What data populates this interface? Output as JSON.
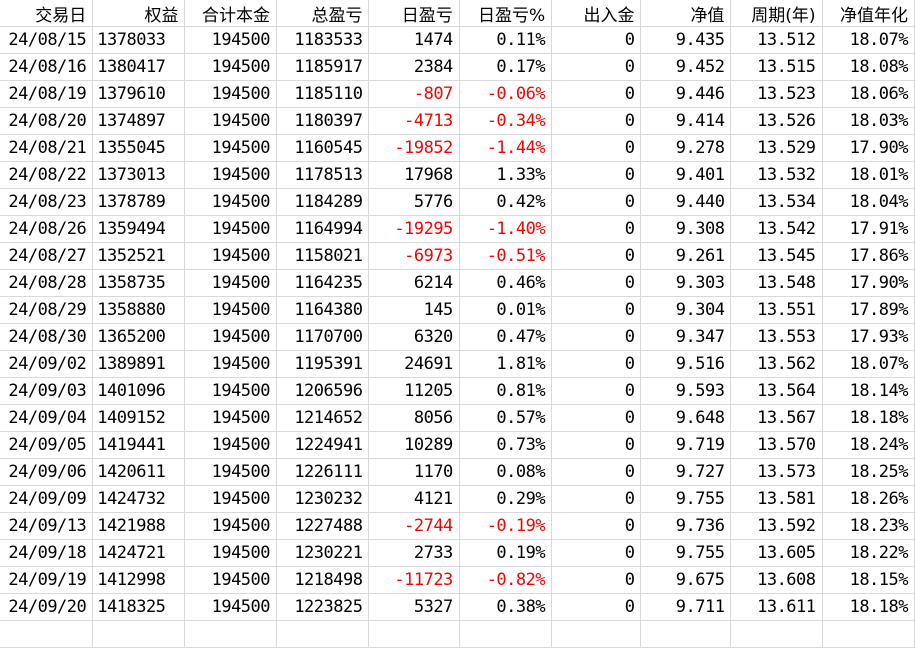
{
  "headers": [
    "交易日",
    "权益",
    "合计本金",
    "总盈亏",
    "日盈亏",
    "日盈亏%",
    "出入金",
    "净值",
    "周期(年)",
    "净值年化"
  ],
  "rows": [
    [
      "24/08/15",
      "1378033",
      "194500",
      "1183533",
      "1474",
      "0.11%",
      "0",
      "9.435",
      "13.512",
      "18.07%"
    ],
    [
      "24/08/16",
      "1380417",
      "194500",
      "1185917",
      "2384",
      "0.17%",
      "0",
      "9.452",
      "13.515",
      "18.08%"
    ],
    [
      "24/08/19",
      "1379610",
      "194500",
      "1185110",
      "-807",
      "-0.06%",
      "0",
      "9.446",
      "13.523",
      "18.06%"
    ],
    [
      "24/08/20",
      "1374897",
      "194500",
      "1180397",
      "-4713",
      "-0.34%",
      "0",
      "9.414",
      "13.526",
      "18.03%"
    ],
    [
      "24/08/21",
      "1355045",
      "194500",
      "1160545",
      "-19852",
      "-1.44%",
      "0",
      "9.278",
      "13.529",
      "17.90%"
    ],
    [
      "24/08/22",
      "1373013",
      "194500",
      "1178513",
      "17968",
      "1.33%",
      "0",
      "9.401",
      "13.532",
      "18.01%"
    ],
    [
      "24/08/23",
      "1378789",
      "194500",
      "1184289",
      "5776",
      "0.42%",
      "0",
      "9.440",
      "13.534",
      "18.04%"
    ],
    [
      "24/08/26",
      "1359494",
      "194500",
      "1164994",
      "-19295",
      "-1.40%",
      "0",
      "9.308",
      "13.542",
      "17.91%"
    ],
    [
      "24/08/27",
      "1352521",
      "194500",
      "1158021",
      "-6973",
      "-0.51%",
      "0",
      "9.261",
      "13.545",
      "17.86%"
    ],
    [
      "24/08/28",
      "1358735",
      "194500",
      "1164235",
      "6214",
      "0.46%",
      "0",
      "9.303",
      "13.548",
      "17.90%"
    ],
    [
      "24/08/29",
      "1358880",
      "194500",
      "1164380",
      "145",
      "0.01%",
      "0",
      "9.304",
      "13.551",
      "17.89%"
    ],
    [
      "24/08/30",
      "1365200",
      "194500",
      "1170700",
      "6320",
      "0.47%",
      "0",
      "9.347",
      "13.553",
      "17.93%"
    ],
    [
      "24/09/02",
      "1389891",
      "194500",
      "1195391",
      "24691",
      "1.81%",
      "0",
      "9.516",
      "13.562",
      "18.07%"
    ],
    [
      "24/09/03",
      "1401096",
      "194500",
      "1206596",
      "11205",
      "0.81%",
      "0",
      "9.593",
      "13.564",
      "18.14%"
    ],
    [
      "24/09/04",
      "1409152",
      "194500",
      "1214652",
      "8056",
      "0.57%",
      "0",
      "9.648",
      "13.567",
      "18.18%"
    ],
    [
      "24/09/05",
      "1419441",
      "194500",
      "1224941",
      "10289",
      "0.73%",
      "0",
      "9.719",
      "13.570",
      "18.24%"
    ],
    [
      "24/09/06",
      "1420611",
      "194500",
      "1226111",
      "1170",
      "0.08%",
      "0",
      "9.727",
      "13.573",
      "18.25%"
    ],
    [
      "24/09/09",
      "1424732",
      "194500",
      "1230232",
      "4121",
      "0.29%",
      "0",
      "9.755",
      "13.581",
      "18.26%"
    ],
    [
      "24/09/13",
      "1421988",
      "194500",
      "1227488",
      "-2744",
      "-0.19%",
      "0",
      "9.736",
      "13.592",
      "18.23%"
    ],
    [
      "24/09/18",
      "1424721",
      "194500",
      "1230221",
      "2733",
      "0.19%",
      "0",
      "9.755",
      "13.605",
      "18.22%"
    ],
    [
      "24/09/19",
      "1412998",
      "194500",
      "1218498",
      "-11723",
      "-0.82%",
      "0",
      "9.675",
      "13.608",
      "18.15%"
    ],
    [
      "24/09/20",
      "1418325",
      "194500",
      "1223825",
      "5327",
      "0.38%",
      "0",
      "9.711",
      "13.611",
      "18.18%"
    ]
  ],
  "colors": {
    "negative": "#ff0000",
    "gridline": "#d9d9d9"
  }
}
